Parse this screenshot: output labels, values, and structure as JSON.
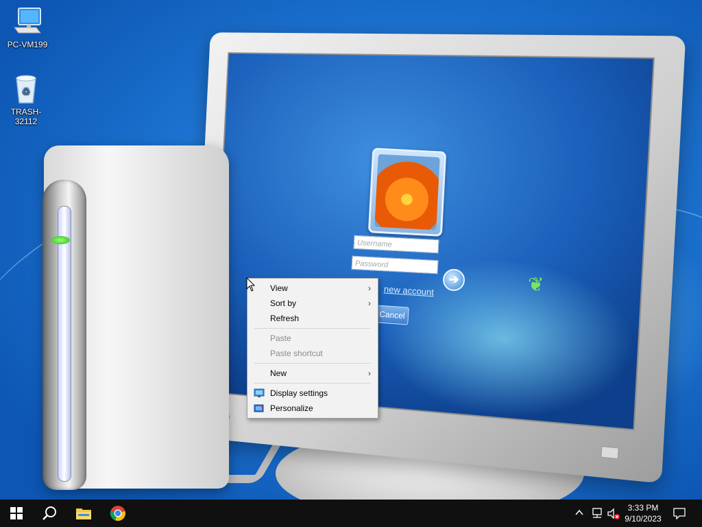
{
  "desktop": {
    "icons": [
      {
        "label": "PC-VM199",
        "icon": "computer-icon"
      },
      {
        "label": "TRASH-32112",
        "icon": "recycle-bin-icon"
      }
    ]
  },
  "wallpaper": {
    "login_username_placeholder": "Username",
    "login_password_placeholder": "Password",
    "login_link": "new account",
    "login_cancel": "Cancel"
  },
  "context_menu": {
    "items": [
      {
        "label": "View",
        "submenu": true,
        "enabled": true
      },
      {
        "label": "Sort by",
        "submenu": true,
        "enabled": true
      },
      {
        "label": "Refresh",
        "submenu": false,
        "enabled": true
      },
      {
        "label": "Paste",
        "submenu": false,
        "enabled": false
      },
      {
        "label": "Paste shortcut",
        "submenu": false,
        "enabled": false
      },
      {
        "label": "New",
        "submenu": true,
        "enabled": true
      },
      {
        "label": "Display settings",
        "icon": "display-settings-icon",
        "enabled": true
      },
      {
        "label": "Personalize",
        "icon": "personalize-icon",
        "enabled": true
      }
    ],
    "submenu_arrow": "›"
  },
  "taskbar": {
    "pinned": [
      "start-icon",
      "search-icon",
      "file-explorer-icon",
      "chrome-icon"
    ],
    "tray": {
      "chevron": "^",
      "time": "3:33 PM",
      "date": "9/10/2023"
    }
  },
  "colors": {
    "taskbar_bg": "#101010",
    "menu_bg": "#f2f2f2",
    "wallpaper_blue": "#1f78d6"
  }
}
